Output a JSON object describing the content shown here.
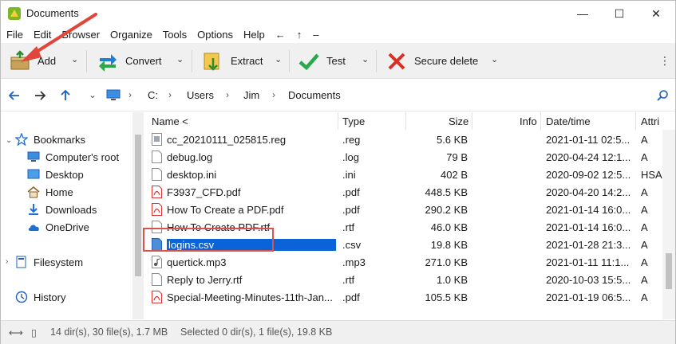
{
  "window": {
    "title": "Documents",
    "minimize": "—",
    "maximize": "☐",
    "close": "✕"
  },
  "menu": {
    "items": [
      "File",
      "Edit",
      "Browser",
      "Organize",
      "Tools",
      "Options",
      "Help"
    ],
    "glyphs": [
      "←",
      "↑",
      "–"
    ]
  },
  "toolbar": {
    "add_label": "Add",
    "convert_label": "Convert",
    "extract_label": "Extract",
    "test_label": "Test",
    "secure_delete_label": "Secure delete",
    "drop": "⌄",
    "more": "⋮"
  },
  "address": {
    "crumbs": [
      "C:",
      "Users",
      "Jim",
      "Documents"
    ],
    "sep": "›",
    "drop": "⌄"
  },
  "tree": {
    "bookmarks": "Bookmarks",
    "computers_root": "Computer's root",
    "desktop": "Desktop",
    "home": "Home",
    "downloads": "Downloads",
    "onedrive": "OneDrive",
    "filesystem": "Filesystem",
    "history": "History"
  },
  "columns": {
    "name": "Name <",
    "type": "Type",
    "size": "Size",
    "info": "Info",
    "date": "Date/time",
    "attr": "Attri"
  },
  "files": [
    {
      "name": "cc_20210111_025815.reg",
      "type": ".reg",
      "size": "5.6 KB",
      "date": "2021-01-11 02:5...",
      "attr": "A",
      "icon": "reg-file-icon"
    },
    {
      "name": "debug.log",
      "type": ".log",
      "size": "79 B",
      "date": "2020-04-24 12:1...",
      "attr": "A",
      "icon": "text-file-icon"
    },
    {
      "name": "desktop.ini",
      "type": ".ini",
      "size": "402 B",
      "date": "2020-09-02 12:5...",
      "attr": "HSA",
      "icon": "text-file-icon"
    },
    {
      "name": "F3937_CFD.pdf",
      "type": ".pdf",
      "size": "448.5 KB",
      "date": "2020-04-20 14:2...",
      "attr": "A",
      "icon": "pdf-file-icon"
    },
    {
      "name": "How To Create a PDF.pdf",
      "type": ".pdf",
      "size": "290.2 KB",
      "date": "2021-01-14 16:0...",
      "attr": "A",
      "icon": "pdf-file-icon"
    },
    {
      "name": "How To Create PDF.rtf",
      "type": ".rtf",
      "size": "46.0 KB",
      "date": "2021-01-14 16:0...",
      "attr": "A",
      "icon": "text-file-icon"
    },
    {
      "name": "logins.csv",
      "type": ".csv",
      "size": "19.8 KB",
      "date": "2021-01-28 21:3...",
      "attr": "A",
      "icon": "csv-file-icon"
    },
    {
      "name": "quertick.mp3",
      "type": ".mp3",
      "size": "271.0 KB",
      "date": "2021-01-11 11:1...",
      "attr": "A",
      "icon": "audio-file-icon"
    },
    {
      "name": "Reply to Jerry.rtf",
      "type": ".rtf",
      "size": "1.0 KB",
      "date": "2020-10-03 15:5...",
      "attr": "A",
      "icon": "text-file-icon"
    },
    {
      "name": "Special-Meeting-Minutes-11th-Jan...",
      "type": ".pdf",
      "size": "105.5 KB",
      "date": "2021-01-19 06:5...",
      "attr": "A",
      "icon": "pdf-file-icon"
    }
  ],
  "status": {
    "counts": "14 dir(s), 30 file(s), 1.7 MB",
    "selected": "Selected 0 dir(s), 1 file(s), 19.8 KB"
  },
  "colors": {
    "selection": "#0a64d8",
    "highlight_box": "#d9534f",
    "arrow": "#e0463a"
  }
}
